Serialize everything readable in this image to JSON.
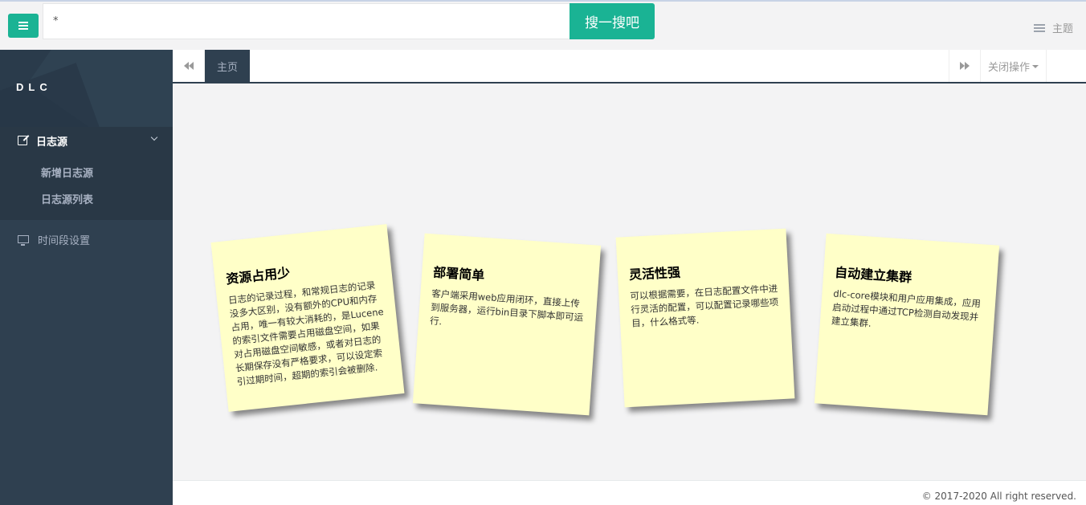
{
  "search": {
    "value": "*",
    "button_label": "搜一搜吧"
  },
  "header": {
    "theme_label": "主题"
  },
  "sidebar": {
    "brand": "DLC",
    "groups": [
      {
        "label": "日志源",
        "items": [
          {
            "label": "新增日志源"
          },
          {
            "label": "日志源列表"
          }
        ]
      },
      {
        "label": "时间段设置"
      }
    ]
  },
  "tabs": {
    "home_label": "主页",
    "close_ops_label": "关闭操作"
  },
  "notes": [
    {
      "title": "资源占用少",
      "text": "日志的记录过程，和常规日志的记录没多大区别，没有额外的CPU和内存占用，唯一有较大消耗的，是Lucene的索引文件需要占用磁盘空间，如果对占用磁盘空间敏感，或者对日志的长期保存没有严格要求，可以设定索引过期时间，超期的索引会被删除."
    },
    {
      "title": "部署简单",
      "text": "客户端采用web应用闭环，直接上传到服务器，运行bin目录下脚本即可运行."
    },
    {
      "title": "灵活性强",
      "text": "可以根据需要，在日志配置文件中进行灵活的配置，可以配置记录哪些项目，什么格式等."
    },
    {
      "title": "自动建立集群",
      "text": "dlc-core模块和用户应用集成，应用启动过程中通过TCP检测自动发现并建立集群."
    }
  ],
  "footer": {
    "copyright": "© 2017-2020 All right reserved."
  },
  "colors": {
    "accent": "#1ab394",
    "sidebar_bg": "#2f4050",
    "note_bg": "#ffffc8"
  }
}
